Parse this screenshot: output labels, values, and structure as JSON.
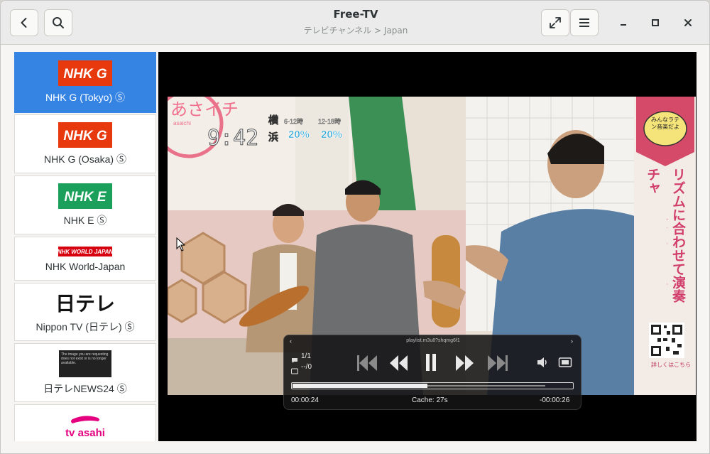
{
  "window": {
    "title": "Free-TV",
    "breadcrumb": "テレビチャンネル > Japan"
  },
  "icons": {
    "back": "go-back-icon",
    "search": "search-icon",
    "fullscreen": "fullscreen-icon",
    "menu": "hamburger-menu-icon",
    "minimize": "minimize-icon",
    "maximize": "maximize-icon",
    "close": "close-icon"
  },
  "channels": [
    {
      "name": "NHK G (Tokyo) Ⓢ",
      "logo_text": "NHK G",
      "logo_color": "#e8380d",
      "selected": true
    },
    {
      "name": "NHK G (Osaka) Ⓢ",
      "logo_text": "NHK G",
      "logo_color": "#e8380d",
      "selected": false
    },
    {
      "name": "NHK E Ⓢ",
      "logo_text": "NHK E",
      "logo_color": "#1aa05a",
      "selected": false
    },
    {
      "name": "NHK World-Japan",
      "logo_text": "NHK WORLD JAPAN",
      "logo_color": "#d7000f",
      "selected": false
    },
    {
      "name": "Nippon TV (日テレ) Ⓢ",
      "logo_text": "日テレ",
      "logo_color": "#111111",
      "selected": false
    },
    {
      "name": "日テレNEWS24 Ⓢ",
      "logo_text": "The image you are requesting does not exist or is no longer available.",
      "logo_color": "#222222",
      "selected": false
    },
    {
      "name": "",
      "logo_text": "tv asahi",
      "logo_color": "#e4007f",
      "selected": false
    }
  ],
  "video": {
    "show_logo": "あさイチ",
    "show_logo_romaji": "asaichi",
    "clock": "9:42",
    "weather_cities": [
      "横",
      "浜"
    ],
    "weather_times": [
      "6-12時",
      "12-18時"
    ],
    "weather_values": [
      "20%",
      "20%"
    ],
    "side_banner_badge": "みんなラテン音楽だよ",
    "side_banner_text_left": "キューバ★チャ・チャ・チャ",
    "side_banner_text_right": "リズムに合わせて演奏",
    "qr_caption": "詳しくはこちら"
  },
  "osc": {
    "url": "playlist.m3u8?shqmg6f1",
    "subtitle_count": "1/1",
    "audio_count": "--/0",
    "elapsed": "00:00:24",
    "cache": "Cache:  27s",
    "remaining": "-00:00:26",
    "progress": 0.48,
    "buffer": 0.9
  }
}
